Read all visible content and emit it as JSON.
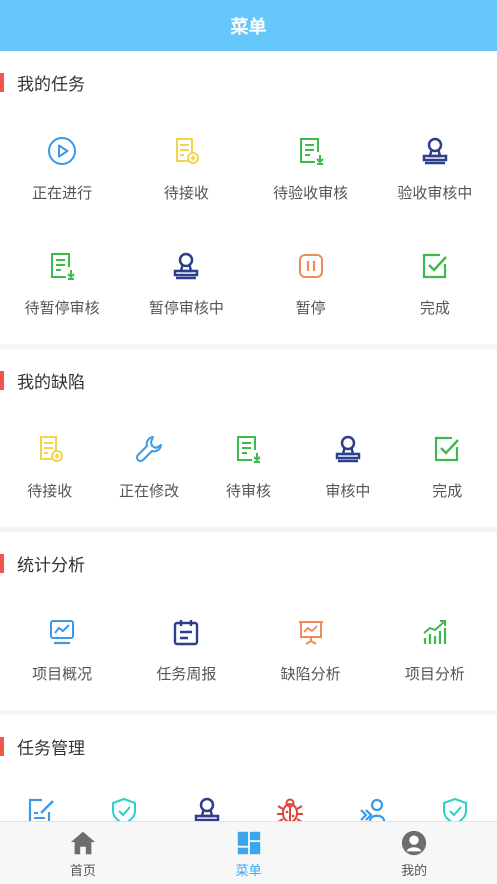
{
  "header": {
    "title": "菜单"
  },
  "sections": [
    {
      "title": "我的任务",
      "items": [
        {
          "label": "正在进行",
          "icon": "play-icon"
        },
        {
          "label": "待接收",
          "icon": "doc-add-icon"
        },
        {
          "label": "待验收审核",
          "icon": "doc-check-icon"
        },
        {
          "label": "验收审核中",
          "icon": "stamp-icon"
        },
        {
          "label": "待暂停审核",
          "icon": "doc-check-icon"
        },
        {
          "label": "暂停审核中",
          "icon": "stamp-icon"
        },
        {
          "label": "暂停",
          "icon": "pause-icon"
        },
        {
          "label": "完成",
          "icon": "checkbox-icon"
        }
      ]
    },
    {
      "title": "我的缺陷",
      "items": [
        {
          "label": "待接收",
          "icon": "doc-add-icon"
        },
        {
          "label": "正在修改",
          "icon": "wrench-icon"
        },
        {
          "label": "待审核",
          "icon": "doc-check-icon"
        },
        {
          "label": "审核中",
          "icon": "stamp-icon"
        },
        {
          "label": "完成",
          "icon": "checkbox-icon"
        }
      ]
    },
    {
      "title": "统计分析",
      "items": [
        {
          "label": "项目概况",
          "icon": "monitor-chart-icon"
        },
        {
          "label": "任务周报",
          "icon": "calendar-icon"
        },
        {
          "label": "缺陷分析",
          "icon": "presentation-icon"
        },
        {
          "label": "项目分析",
          "icon": "growth-chart-icon"
        }
      ]
    },
    {
      "title": "任务管理",
      "items": [
        {
          "icon": "edit-doc-icon"
        },
        {
          "icon": "shield-check-icon"
        },
        {
          "icon": "stamp-icon"
        },
        {
          "icon": "bug-icon"
        },
        {
          "icon": "user-switch-icon"
        },
        {
          "icon": "shield-check-icon"
        }
      ]
    }
  ],
  "tabbar": [
    {
      "label": "首页",
      "icon": "home-icon"
    },
    {
      "label": "菜单",
      "icon": "menu-grid-icon",
      "active": true
    },
    {
      "label": "我的",
      "icon": "profile-icon"
    }
  ],
  "colors": {
    "header": "#66c7fb",
    "section_marker": "#f2564a",
    "active_tab": "#39aaf0"
  }
}
